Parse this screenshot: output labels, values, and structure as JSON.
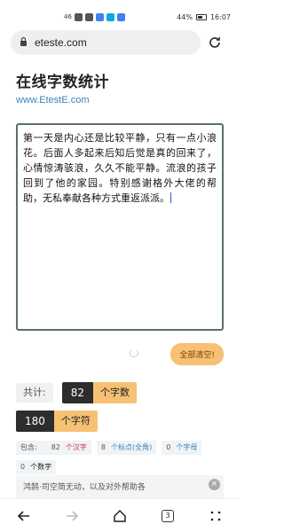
{
  "status": {
    "network": "46",
    "battery": "44%",
    "time": "16:07"
  },
  "browser": {
    "url": "eteste.com",
    "tab_count": "3"
  },
  "page": {
    "title": "在线字数统计",
    "subtitle": "www.EtestE.com"
  },
  "editor": {
    "text": "第一天是内心还是比较平静，只有一点小浪花。后面人多起来后知后觉是真的回来了，心情惊涛骇浪，久久不能平静。流浪的孩子回到了他的家园。特别感谢格外大佬的帮助，无私奉献各种方式重返派派。"
  },
  "actions": {
    "clear_label": "全部清空!"
  },
  "stats": {
    "total_label": "共计:",
    "word_count": "82",
    "word_unit": "个字数",
    "char_count": "180",
    "char_unit": "个字符",
    "include_label": "包含:",
    "hanzi_count": "82",
    "hanzi_label": "个汉字",
    "punct_count": "8",
    "punct_label": "个标点(全角)",
    "letter_count": "0",
    "letter_label": "个字母",
    "digit_count": "0",
    "digit_label": "个数字"
  },
  "ad": {
    "text": "鸿鹄·司空简无动，以及对外帮助各"
  }
}
